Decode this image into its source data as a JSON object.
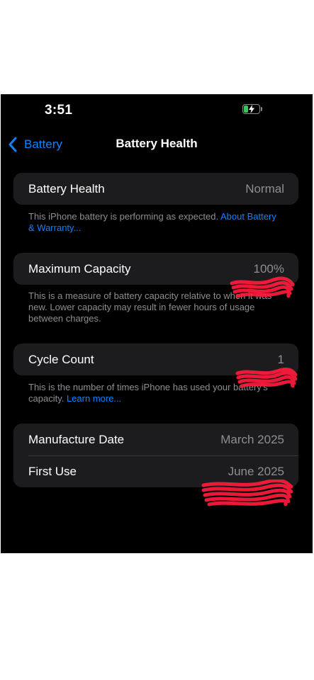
{
  "status_bar": {
    "time": "3:51",
    "battery_icon": "battery-charging-icon"
  },
  "nav": {
    "back_label": "Battery",
    "title": "Battery Health"
  },
  "health": {
    "label": "Battery Health",
    "value": "Normal",
    "footer_text": "This iPhone battery is performing as expected. ",
    "footer_link": "About Battery & Warranty..."
  },
  "capacity": {
    "label": "Maximum Capacity",
    "value": "100%",
    "footer_text": "This is a measure of battery capacity relative to when it was new. Lower capacity may result in fewer hours of usage between charges."
  },
  "cycles": {
    "label": "Cycle Count",
    "value": "1",
    "footer_text": "This is the number of times iPhone has used your battery's capacity. ",
    "footer_link": "Learn more..."
  },
  "dates": {
    "rows": [
      {
        "label": "Manufacture Date",
        "value": "March 2025"
      },
      {
        "label": "First Use",
        "value": "June 2025"
      }
    ]
  },
  "colors": {
    "accent": "#0a84ff",
    "group_bg": "#1c1c1e",
    "secondary_text": "#8e8e93",
    "battery_fill": "#34c759",
    "redaction": "#ff1a3c"
  }
}
